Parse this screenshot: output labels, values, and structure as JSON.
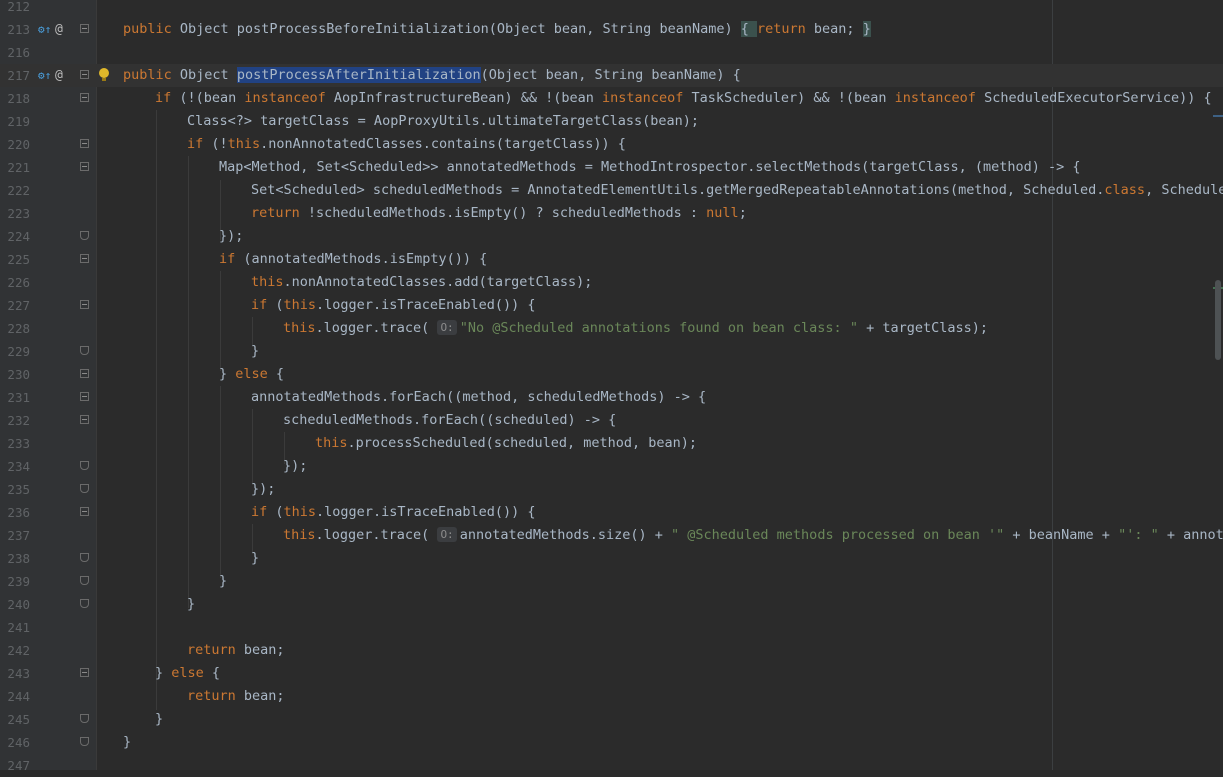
{
  "editor": {
    "colors": {
      "background": "#2b2b2b",
      "gutter": "#313335",
      "keyword": "#cc7832",
      "string": "#6a8759",
      "plain": "#a9b7c6",
      "selection": "#214283"
    },
    "line_numbers": [
      "212",
      "213",
      "216",
      "217",
      "218",
      "219",
      "220",
      "221",
      "222",
      "223",
      "224",
      "225",
      "226",
      "227",
      "228",
      "229",
      "230",
      "231",
      "232",
      "233",
      "234",
      "235",
      "236",
      "237",
      "238",
      "239",
      "240",
      "241",
      "242",
      "243",
      "244",
      "245",
      "246",
      "247"
    ],
    "gutter_icons": {
      "override_icon": "implements-method-icon",
      "annotation_icon": "annotation-at-icon",
      "bulb_icon": "intention-bulb-icon",
      "fold_icon": "fold-marker-icon"
    },
    "param_hint_label": "O:",
    "code": {
      "l213": {
        "a": "public",
        "b": " Object postProcessBeforeInitialization(Object bean, String beanName) ",
        "c": "{ ",
        "d": "return",
        "e": " bean; ",
        "f": "}"
      },
      "l217": {
        "a": "public",
        "b": " Object ",
        "c": "postProcessAfterInitialization",
        "d": "(Object bean, String beanName) {"
      },
      "l218": {
        "a": "if",
        "b": " (!(bean ",
        "c": "instanceof",
        "d": " AopInfrastructureBean) && !(bean ",
        "e": "instanceof",
        "f": " TaskScheduler) && !(bean ",
        "g": "instanceof",
        "h": " ScheduledExecutorService)) {"
      },
      "l219": {
        "a": "Class<?> targetClass = AopProxyUtils.ultimateTargetClass(bean);"
      },
      "l220": {
        "a": "if",
        "b": " (!",
        "c": "this",
        "d": ".nonAnnotatedClasses.contains(targetClass)) {"
      },
      "l221": {
        "a": "Map<Method, Set<Scheduled>> annotatedMethods = MethodIntrospector.selectMethods(targetClass, (method) -> {"
      },
      "l222": {
        "a": "Set<Scheduled> scheduledMethods = AnnotatedElementUtils.getMergedRepeatableAnnotations(method, Scheduled.",
        "b": "class",
        "c": ", Schedules"
      },
      "l223": {
        "a": "return",
        "b": " !scheduledMethods.isEmpty() ? scheduledMethods : ",
        "c": "null",
        "d": ";"
      },
      "l224": {
        "a": "});"
      },
      "l225": {
        "a": "if",
        "b": " (annotatedMethods.isEmpty()) {"
      },
      "l226": {
        "a": "this",
        "b": ".nonAnnotatedClasses.add(targetClass);"
      },
      "l227": {
        "a": "if",
        "b": " (",
        "c": "this",
        "d": ".logger.isTraceEnabled()) {"
      },
      "l228": {
        "a": "this",
        "b": ".logger.trace( ",
        "c": "\"No @Scheduled annotations found on bean class: \"",
        "d": " + targetClass);"
      },
      "l229": {
        "a": "}"
      },
      "l230": {
        "a": "} ",
        "b": "else",
        "c": " {"
      },
      "l231": {
        "a": "annotatedMethods.forEach((method, scheduledMethods) -> {"
      },
      "l232": {
        "a": "scheduledMethods.forEach((scheduled) -> {"
      },
      "l233": {
        "a": "this",
        "b": ".processScheduled(scheduled, method, bean);"
      },
      "l234": {
        "a": "});"
      },
      "l235": {
        "a": "});"
      },
      "l236": {
        "a": "if",
        "b": " (",
        "c": "this",
        "d": ".logger.isTraceEnabled()) {"
      },
      "l237": {
        "a": "this",
        "b": ".logger.trace( ",
        "c": "annotatedMethods.size() + ",
        "d": "\" @Scheduled methods processed on bean '\"",
        "e": " + beanName + ",
        "f": "\"': \"",
        "g": " + annotat"
      },
      "l238": {
        "a": "}"
      },
      "l239": {
        "a": "}"
      },
      "l240": {
        "a": "}"
      },
      "l242": {
        "a": "return",
        "b": " bean;"
      },
      "l243": {
        "a": "} ",
        "b": "else",
        "c": " {"
      },
      "l244": {
        "a": "return",
        "b": " bean;"
      },
      "l245": {
        "a": "}"
      },
      "l246": {
        "a": "}"
      }
    }
  }
}
